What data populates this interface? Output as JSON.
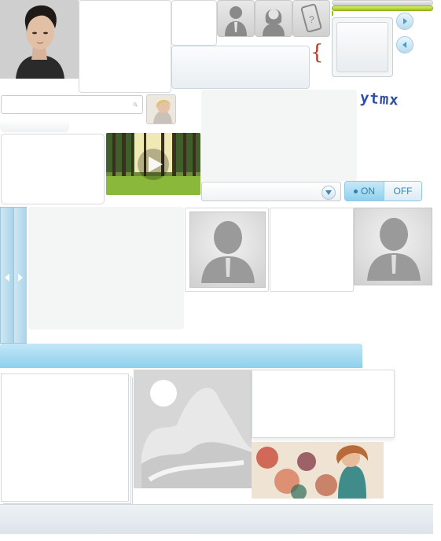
{
  "search": {
    "value": "",
    "placeholder": ""
  },
  "select": {
    "value": ""
  },
  "toggle": {
    "on_label": "ON",
    "off_label": "OFF"
  },
  "captcha": {
    "text": "ytmx"
  },
  "decor": {
    "brace": "{"
  },
  "progress": {
    "bar_1": 1.0,
    "bar_2": 1.0
  },
  "icons": {
    "search": "search-icon",
    "play": "play-icon",
    "chevron_down": "chevron-down-icon",
    "arrow_right": "arrow-right-icon",
    "arrow_left": "arrow-left-icon",
    "male_avatar": "male-avatar-icon",
    "female_avatar": "female-avatar-icon",
    "mobile_help": "mobile-help-icon",
    "landscape_placeholder": "landscape-placeholder-icon"
  },
  "colors": {
    "accent_blue": "#8dd0ec",
    "green": "#9ec21c",
    "captcha": "#2d4fa6"
  }
}
